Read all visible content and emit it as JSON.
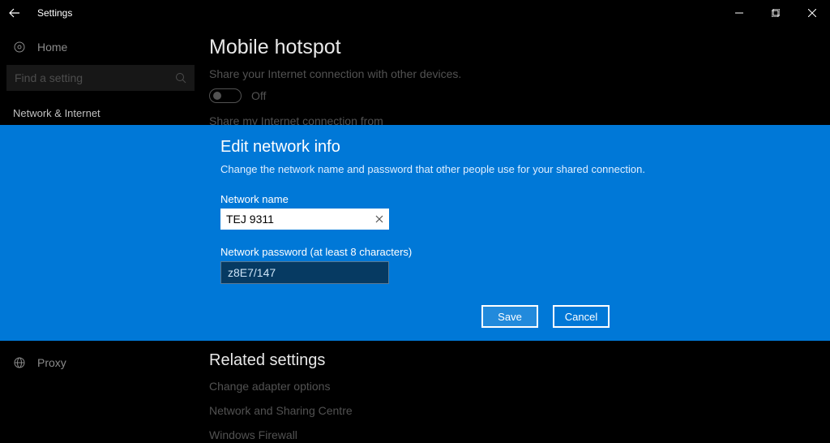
{
  "window": {
    "title": "Settings"
  },
  "sidebar": {
    "home_label": "Home",
    "search_placeholder": "Find a setting",
    "category_label": "Network & Internet",
    "proxy_label": "Proxy"
  },
  "main": {
    "section_title": "Mobile hotspot",
    "share_desc": "Share your Internet connection with other devices.",
    "toggle_label": "Off",
    "share_from_label": "Share my Internet connection from",
    "related_title": "Related settings",
    "related_links": [
      "Change adapter options",
      "Network and Sharing Centre",
      "Windows Firewall"
    ]
  },
  "dialog": {
    "title": "Edit network info",
    "desc": "Change the network name and password that other people use for your shared connection.",
    "name_label": "Network name",
    "name_value": "TEJ 9311",
    "password_label": "Network password (at least 8 characters)",
    "password_value": "z8E7/147",
    "save_label": "Save",
    "cancel_label": "Cancel"
  }
}
